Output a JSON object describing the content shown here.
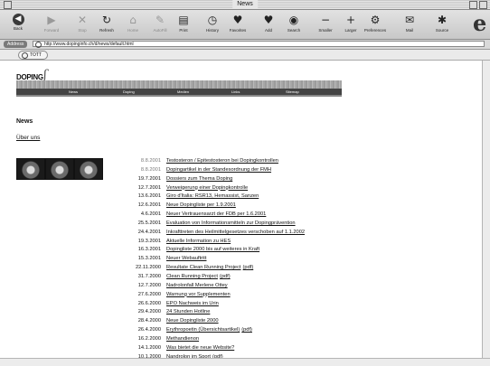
{
  "window": {
    "title": "News"
  },
  "toolbar": {
    "buttons": [
      {
        "label": "Back",
        "icon": "back-arrow",
        "glyph": "◀",
        "dim": false
      },
      {
        "label": "Forward",
        "icon": "forward-arrow",
        "glyph": "▶",
        "dim": true
      },
      {
        "label": "Stop",
        "icon": "stop",
        "glyph": "✕",
        "dim": true
      },
      {
        "label": "Refresh",
        "icon": "refresh",
        "glyph": "↻",
        "dim": false
      },
      {
        "label": "Home",
        "icon": "home",
        "glyph": "⌂",
        "dim": true
      },
      {
        "label": "AutoFill",
        "icon": "autofill",
        "glyph": "✎",
        "dim": true
      },
      {
        "label": "Print",
        "icon": "print",
        "glyph": "▤",
        "dim": false
      },
      {
        "label": "History",
        "icon": "history",
        "glyph": "◷",
        "dim": false
      },
      {
        "label": "Favorites",
        "icon": "favorites",
        "glyph": "♥",
        "dim": false
      },
      {
        "label": "Add",
        "icon": "add",
        "glyph": "♥",
        "dim": false
      },
      {
        "label": "Search",
        "icon": "search",
        "glyph": "◉",
        "dim": false
      },
      {
        "label": "Smaller",
        "icon": "smaller",
        "glyph": "−",
        "dim": false
      },
      {
        "label": "Larger",
        "icon": "larger",
        "glyph": "+",
        "dim": false
      },
      {
        "label": "Preferences",
        "icon": "preferences",
        "glyph": "⚙",
        "dim": false
      },
      {
        "label": "Mail",
        "icon": "mail",
        "glyph": "✉",
        "dim": false
      },
      {
        "label": "Source",
        "icon": "source",
        "glyph": "✱",
        "dim": false
      }
    ]
  },
  "address": {
    "label": "Address",
    "url": "http://www.dopinginfo.ch/d/news/default.html"
  },
  "favorites_bar": {
    "item": "TOTT"
  },
  "site": {
    "logo_text": "DOPING",
    "nav": [
      "News",
      "Doping",
      "Medien",
      "Links",
      "Sitemap"
    ],
    "heading": "News",
    "about_link": "Über uns"
  },
  "news": [
    {
      "date": "8.8.2001",
      "title": "Testosteron / Epitestosteron bei Dopingkontrollen",
      "pdf": "",
      "grey": true
    },
    {
      "date": "8.8.2001",
      "title": "Dopingartikel in der Standesordnung der FMH",
      "pdf": "",
      "grey": true
    },
    {
      "date": "19.7.2001",
      "title": "Dossiers zum Thema Doping",
      "pdf": "",
      "grey": false
    },
    {
      "date": "12.7.2001",
      "title": "Verweigerung einer Dopingkontrolle",
      "pdf": "",
      "grey": false
    },
    {
      "date": "13.6.2001",
      "title": "Giro d'Italia: RSR13, Hemassist, Sanzen",
      "pdf": "",
      "grey": false
    },
    {
      "date": "12.6.2001",
      "title": "Neue Dopingliste per 1.9.2001",
      "pdf": "",
      "grey": false
    },
    {
      "date": "4.6.2001",
      "title": "Neuer Vertrauensarzt der FDB per 1.6.2001",
      "pdf": "",
      "grey": false
    },
    {
      "date": "25.5.2001",
      "title": "Evaluation von Informationsmitteln zur Dopingprävention",
      "pdf": "",
      "grey": false
    },
    {
      "date": "24.4.2001",
      "title": "Inkrafttreten des Heilmittelgesetzes verschoben auf 1.1.2002",
      "pdf": "",
      "grey": false
    },
    {
      "date": "19.3.2001",
      "title": "Aktuelle Information zu HES",
      "pdf": "",
      "grey": false
    },
    {
      "date": "16.3.2001",
      "title": "Dopingliste 2000 bis auf weiteres in Kraft",
      "pdf": "",
      "grey": false
    },
    {
      "date": "15.3.2001",
      "title": "Neuer Webauftritt",
      "pdf": "",
      "grey": false
    },
    {
      "date": "22.11.2000",
      "title": "Resultate Clean Running Project",
      "pdf": "(pdf)",
      "grey": false
    },
    {
      "date": "31.7.2000",
      "title": "Clean Running Project",
      "pdf": "(pdf)",
      "grey": false
    },
    {
      "date": "12.7.2000",
      "title": "Nadrolonfall Merlene Ottey",
      "pdf": "",
      "grey": false
    },
    {
      "date": "27.6.2000",
      "title": "Warnung vor Supplementen",
      "pdf": "",
      "grey": false
    },
    {
      "date": "26.6.2000",
      "title": "EPO Nachweis im Urin",
      "pdf": "",
      "grey": false
    },
    {
      "date": "29.4.2000",
      "title": "24 Stunden Hotline",
      "pdf": "",
      "grey": false
    },
    {
      "date": "28.4.2000",
      "title": "Neue Dopingliste 2000",
      "pdf": "",
      "grey": false
    },
    {
      "date": "26.4.2000",
      "title": "Erythropoetin (Übersichtsartikel)",
      "pdf": "(pdf)",
      "grey": false
    },
    {
      "date": "16.2.2000",
      "title": "Methandienon",
      "pdf": "",
      "grey": false
    },
    {
      "date": "14.1.2000",
      "title": "Was bietet die neue Website?",
      "pdf": "",
      "grey": false
    },
    {
      "date": "10.1.2000",
      "title": "Nandrolon im Sport",
      "pdf": "(pdf)",
      "grey": false
    }
  ]
}
